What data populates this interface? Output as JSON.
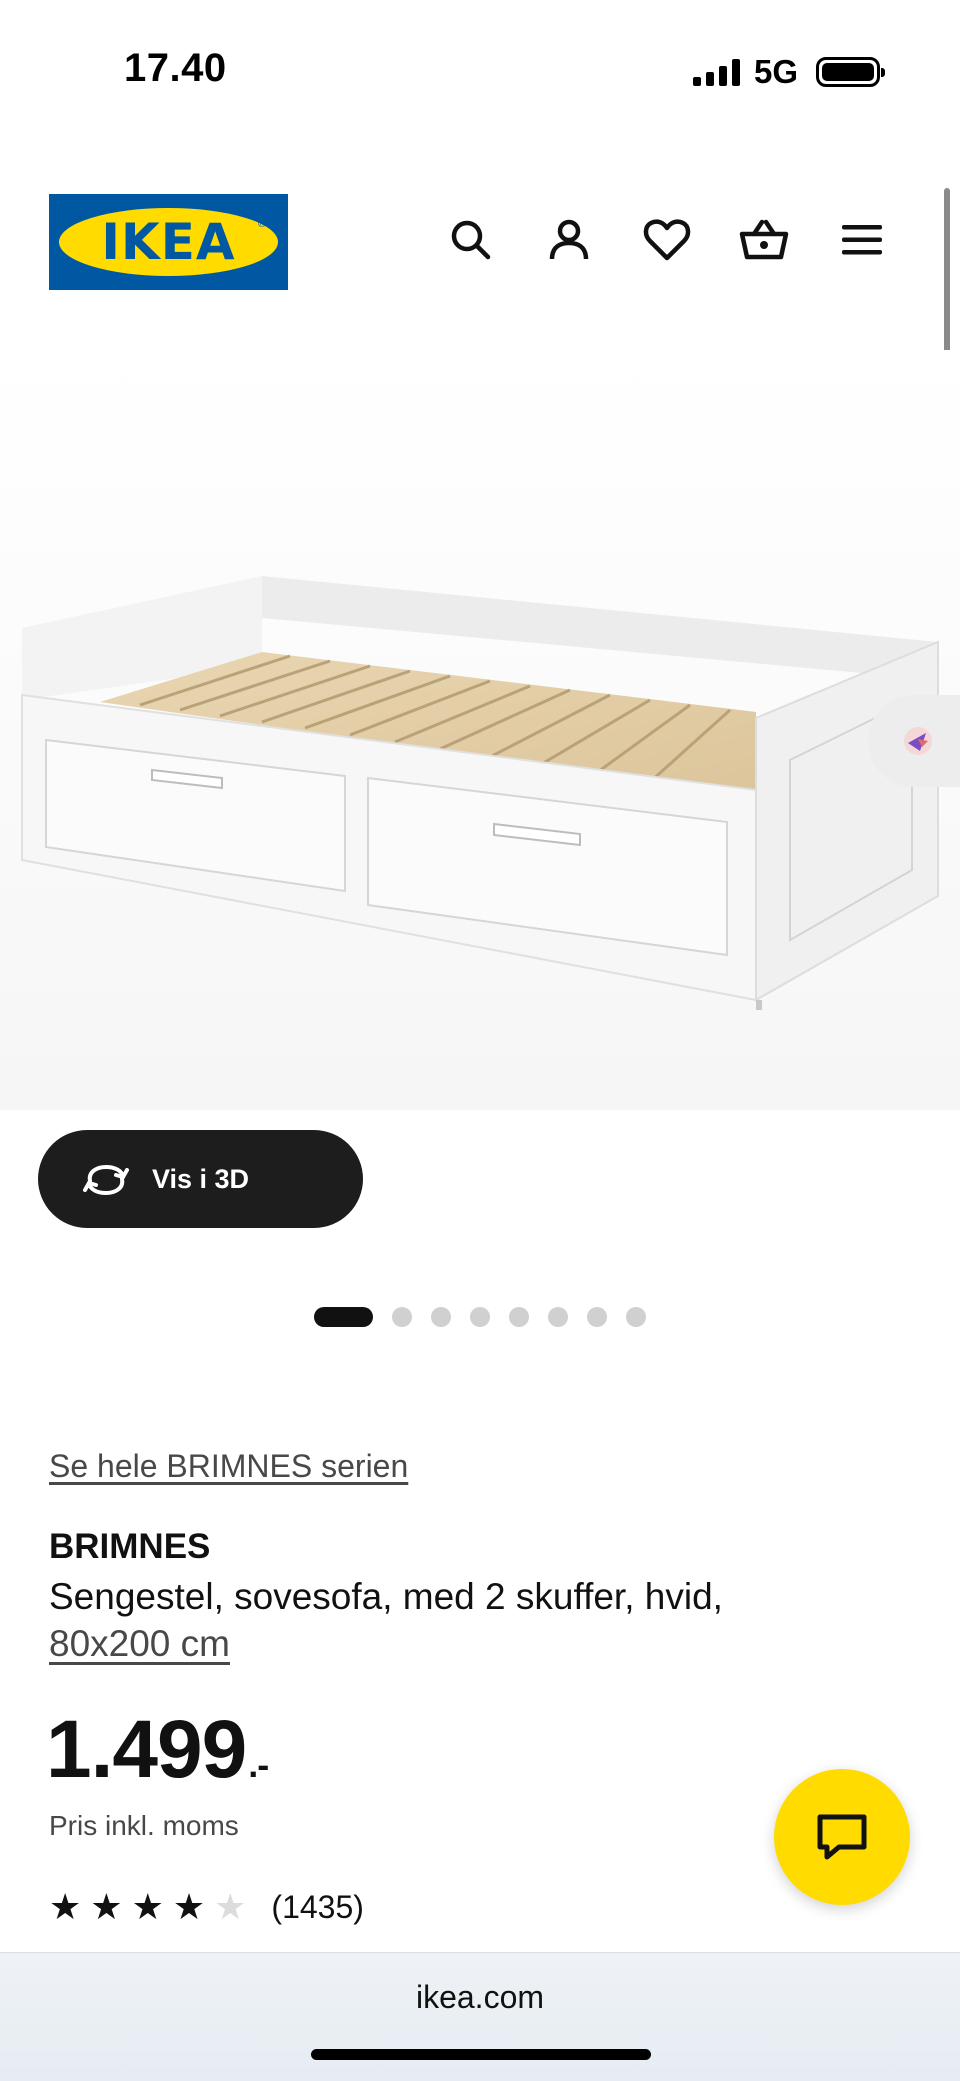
{
  "status_bar": {
    "time": "17.40",
    "network": "5G",
    "signal_bars": 4,
    "battery_level": 0.9
  },
  "header": {
    "logo_text": "IKEA",
    "icons": [
      "search-icon",
      "account-icon",
      "favorites-icon",
      "basket-icon",
      "menu-icon"
    ],
    "colors": {
      "logo_blue": "#0058a3",
      "logo_yellow": "#ffdb00"
    }
  },
  "hero": {
    "favorite_icon": "heart-icon",
    "view_3d_label": "Vis i 3D",
    "image_count": 8,
    "active_image_index": 0
  },
  "product": {
    "series_link": "Se hele BRIMNES serien",
    "name": "BRIMNES",
    "description": "Sengestel, sovesofa, med 2 skuffer, hvid,",
    "size": "80x200 cm",
    "price": "1.499",
    "price_suffix": ".-",
    "price_note": "Pris inkl. moms",
    "rating_value": 4,
    "rating_max": 5,
    "review_count": "(1435)"
  },
  "chat": {
    "icon": "chat-icon",
    "color": "#ffdb00"
  },
  "browser": {
    "url": "ikea.com"
  }
}
